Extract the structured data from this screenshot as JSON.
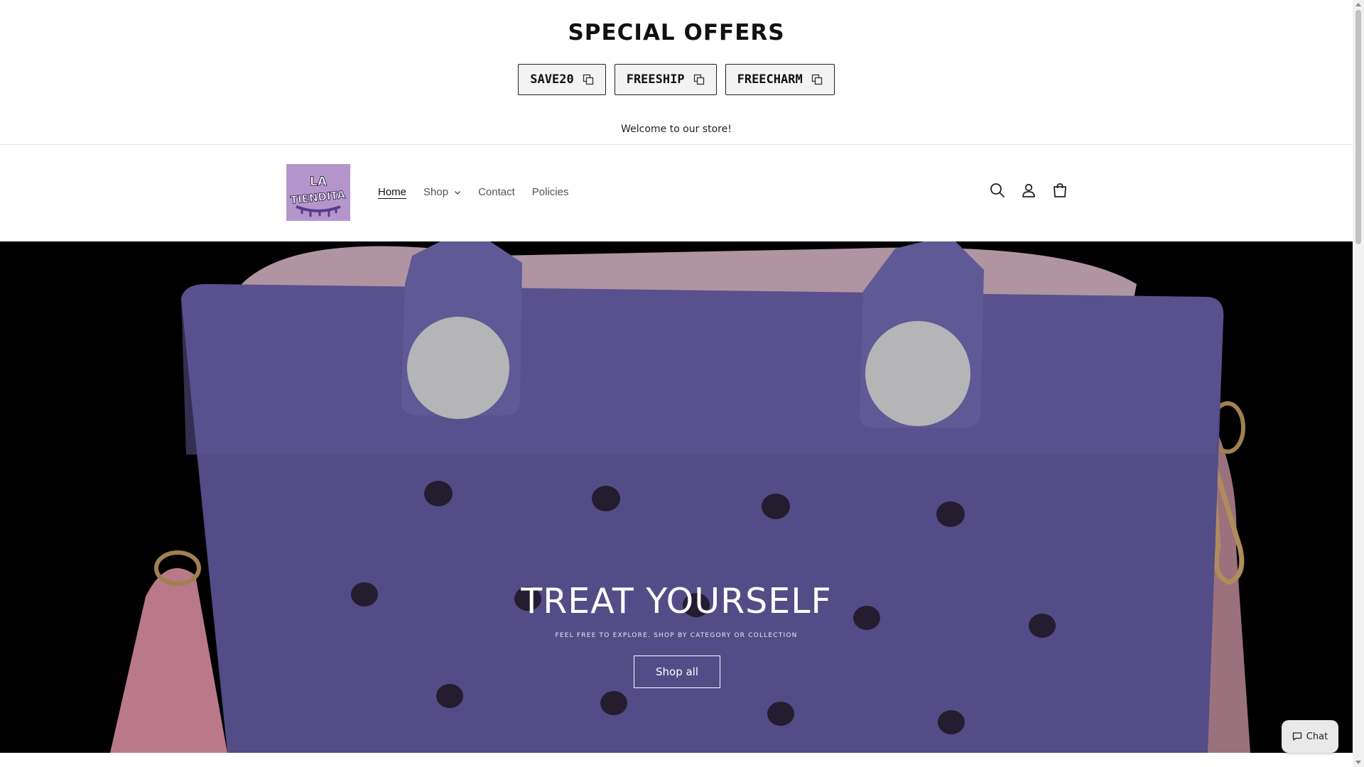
{
  "promo": {
    "title": "SPECIAL OFFERS",
    "codes": [
      {
        "code": "SAVE20"
      },
      {
        "code": "FREESHIP"
      },
      {
        "code": "FREECHARM"
      }
    ],
    "welcome": "Welcome to our store!"
  },
  "header": {
    "logo_text": "LA TIENDITA",
    "nav": [
      {
        "label": "Home"
      },
      {
        "label": "Shop"
      },
      {
        "label": "Contact"
      },
      {
        "label": "Policies"
      }
    ],
    "icons": [
      "search-icon",
      "account-icon",
      "cart-icon"
    ]
  },
  "hero": {
    "title": "TREAT YOURSELF",
    "subtitle": "FEEL FREE TO EXPLORE. SHOP BY CATEGORY OR COLLECTION",
    "button_label": "Shop all"
  },
  "chat": {
    "label": "Chat"
  },
  "colors": {
    "bag_purple": "#6b63a8",
    "logo_bg": "#b596cc",
    "strap_pink": "#d38a9c"
  }
}
